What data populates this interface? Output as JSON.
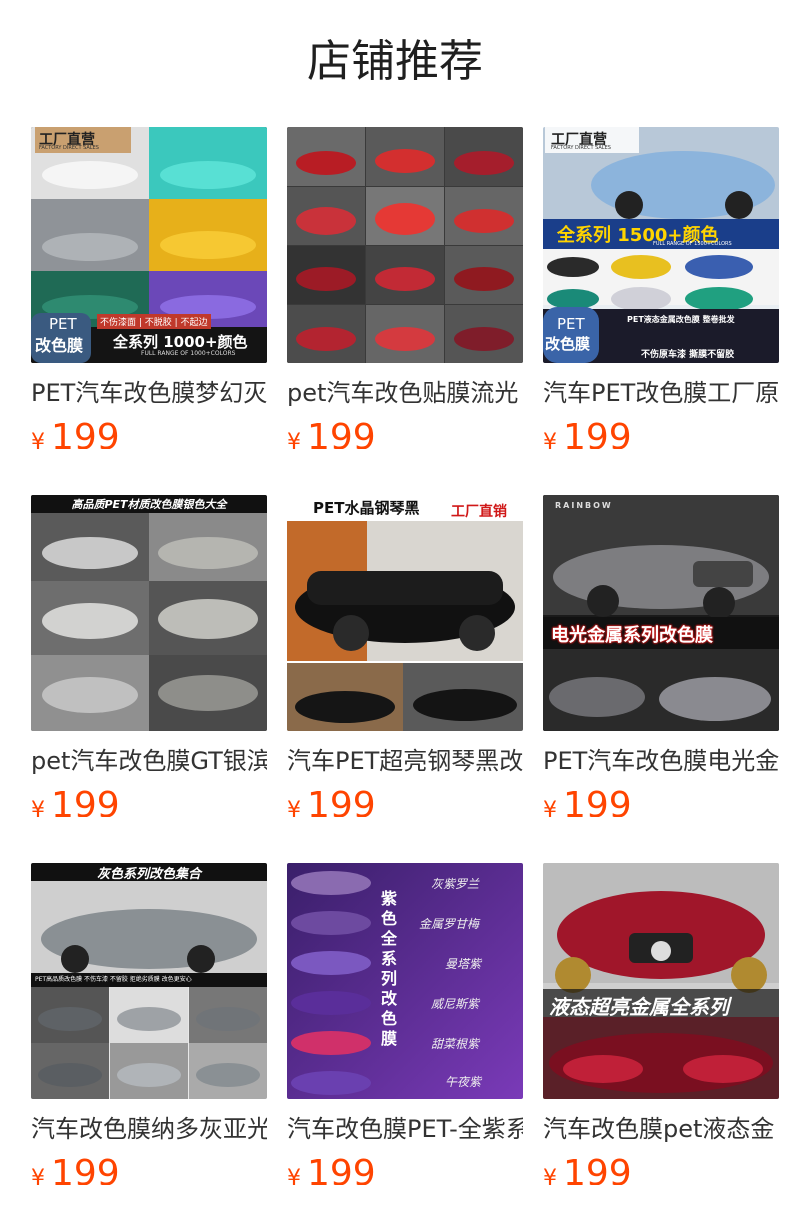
{
  "page": {
    "title": "店铺推荐"
  },
  "colors": {
    "price": "#ff4400",
    "text": "#333333"
  },
  "products": [
    {
      "name": "PET汽车改色膜梦幻灭",
      "currency": "¥",
      "price": "199",
      "badge": "工厂直营",
      "badge_sub": "FACTORY DIRECT SALES",
      "tag1": "PET",
      "tag2": "改色膜",
      "tag3": "不伤漆面 | 不脱胶 | 不起边",
      "banner": "全系列 1000+颜色",
      "banner_sub": "FULL RANGE OF 1000+COLORS",
      "swatches": [
        "#e8e8e8",
        "#3ad0c4",
        "#9a9ea3",
        "#e8b21e",
        "#1f6d57",
        "#6a4bb8"
      ]
    },
    {
      "name": "pet汽车改色贴膜流光",
      "currency": "¥",
      "price": "199",
      "swatches": [
        "#b81d24",
        "#c52a2a",
        "#8f1a20",
        "#d03030",
        "#a31f2b",
        "#c9323a",
        "#9c1b26",
        "#b32430",
        "#7f1d2a",
        "#c22a35",
        "#a51e2c",
        "#d43a3f"
      ]
    },
    {
      "name": "汽车PET改色膜工厂原",
      "currency": "¥",
      "price": "199",
      "badge": "工厂直营",
      "badge_sub": "FACTORY DIRECT SALES",
      "banner": "全系列 1500+颜色",
      "banner_sub": "FULL RANGE OF 1500+COLORS",
      "tag1": "PET",
      "tag2": "改色膜",
      "tag4": "PET液态金属改色膜 整卷批发",
      "tag5": "不伤原车漆 撕膜不留胶",
      "swatches": [
        "#8cb4dc",
        "#2a2a2a",
        "#e8c020",
        "#3a5fb0",
        "#1a8a78",
        "#d0d0d8",
        "#20a080"
      ]
    },
    {
      "name": "pet汽车改色膜GT银滨",
      "currency": "¥",
      "price": "199",
      "banner": "高品质PET材质改色膜银色大全",
      "swatches": [
        "#c8c8c8",
        "#b5b5b0",
        "#d2d2d0",
        "#bdbdb8",
        "#c0c0c0",
        "#8e8e8a"
      ]
    },
    {
      "name": "汽车PET超亮钢琴黑改",
      "currency": "¥",
      "price": "199",
      "banner": "PET水晶钢琴黑",
      "banner_red": "工厂直销",
      "swatches": [
        "#111111",
        "#1a1a1a",
        "#222222"
      ]
    },
    {
      "name": "PET汽车改色膜电光金",
      "currency": "¥",
      "price": "199",
      "banner": "电光金属系列改色膜",
      "brand": "RAINBOW",
      "swatches": [
        "#7d7d80",
        "#6a6a6e",
        "#8a8a90"
      ]
    },
    {
      "name": "汽车改色膜纳多灰亚光",
      "currency": "¥",
      "price": "199",
      "banner": "灰色系列改色集合",
      "tag3": "PET高品质改色膜  不伤车漆  不留胶  拒绝劣质膜  改色更安心",
      "swatches": [
        "#8a9094",
        "#5e6266",
        "#9ea2a6",
        "#707478",
        "#5a5e62",
        "#b0b4b8"
      ]
    },
    {
      "name": "汽车改色膜PET-全紫系",
      "currency": "¥",
      "price": "199",
      "vertical": "紫色全系列改色膜",
      "labels": [
        "灰紫罗兰",
        "金属罗甘梅",
        "曼塔紫",
        "威尼斯紫",
        "甜菜根紫",
        "午夜紫"
      ],
      "swatches": [
        "#8a6bb0",
        "#6d4aa0",
        "#7b58c0",
        "#5a2e9a",
        "#d0306a",
        "#6a40b0"
      ]
    },
    {
      "name": "汽车改色膜pet液态金",
      "currency": "¥",
      "price": "199",
      "banner": "液态超亮金属全系列",
      "swatches": [
        "#a0162a",
        "#7a0f20",
        "#c02038"
      ]
    }
  ]
}
